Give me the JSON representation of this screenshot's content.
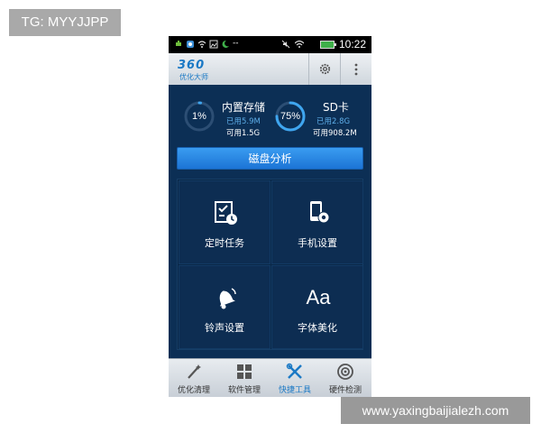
{
  "overlay": {
    "tag": "TG: MYYJJPP",
    "watermark": "www.yaxingbaijialezh.com"
  },
  "status_bar": {
    "time": "10:22",
    "dash": "--",
    "icons": [
      "usb-icon",
      "app-notify-icon",
      "wifi-icon",
      "image-icon",
      "moon-icon",
      "mute-icon",
      "wifi-signal-icon",
      "battery-icon"
    ]
  },
  "header": {
    "logo": "360",
    "logo_sub": "优化大师",
    "settings_icon": "gear-icon",
    "menu_icon": "more-vertical-icon"
  },
  "storage": {
    "internal": {
      "percent_label": "1%",
      "percent": 1,
      "title": "内置存储",
      "used": "已用5.9M",
      "available": "可用1.5G"
    },
    "sd": {
      "percent_label": "75%",
      "percent": 75,
      "title": "SD卡",
      "used": "已用2.8G",
      "available": "可用908.2M"
    }
  },
  "disk_analysis_button": "磁盘分析",
  "tiles": [
    {
      "label": "定时任务",
      "icon": "scheduled-task-icon"
    },
    {
      "label": "手机设置",
      "icon": "phone-settings-icon"
    },
    {
      "label": "铃声设置",
      "icon": "bell-icon"
    },
    {
      "label": "字体美化",
      "icon": "font-icon",
      "glyph": "Aa"
    }
  ],
  "tabs": [
    {
      "label": "优化清理",
      "icon": "magic-wand-icon",
      "active": false
    },
    {
      "label": "软件管理",
      "icon": "apps-grid-icon",
      "active": false
    },
    {
      "label": "快捷工具",
      "icon": "tools-icon",
      "active": true
    },
    {
      "label": "硬件检测",
      "icon": "hardware-detect-icon",
      "active": false
    }
  ],
  "colors": {
    "background": "#0c2f55",
    "accent": "#1b79c5",
    "used_text": "#5dade8"
  }
}
